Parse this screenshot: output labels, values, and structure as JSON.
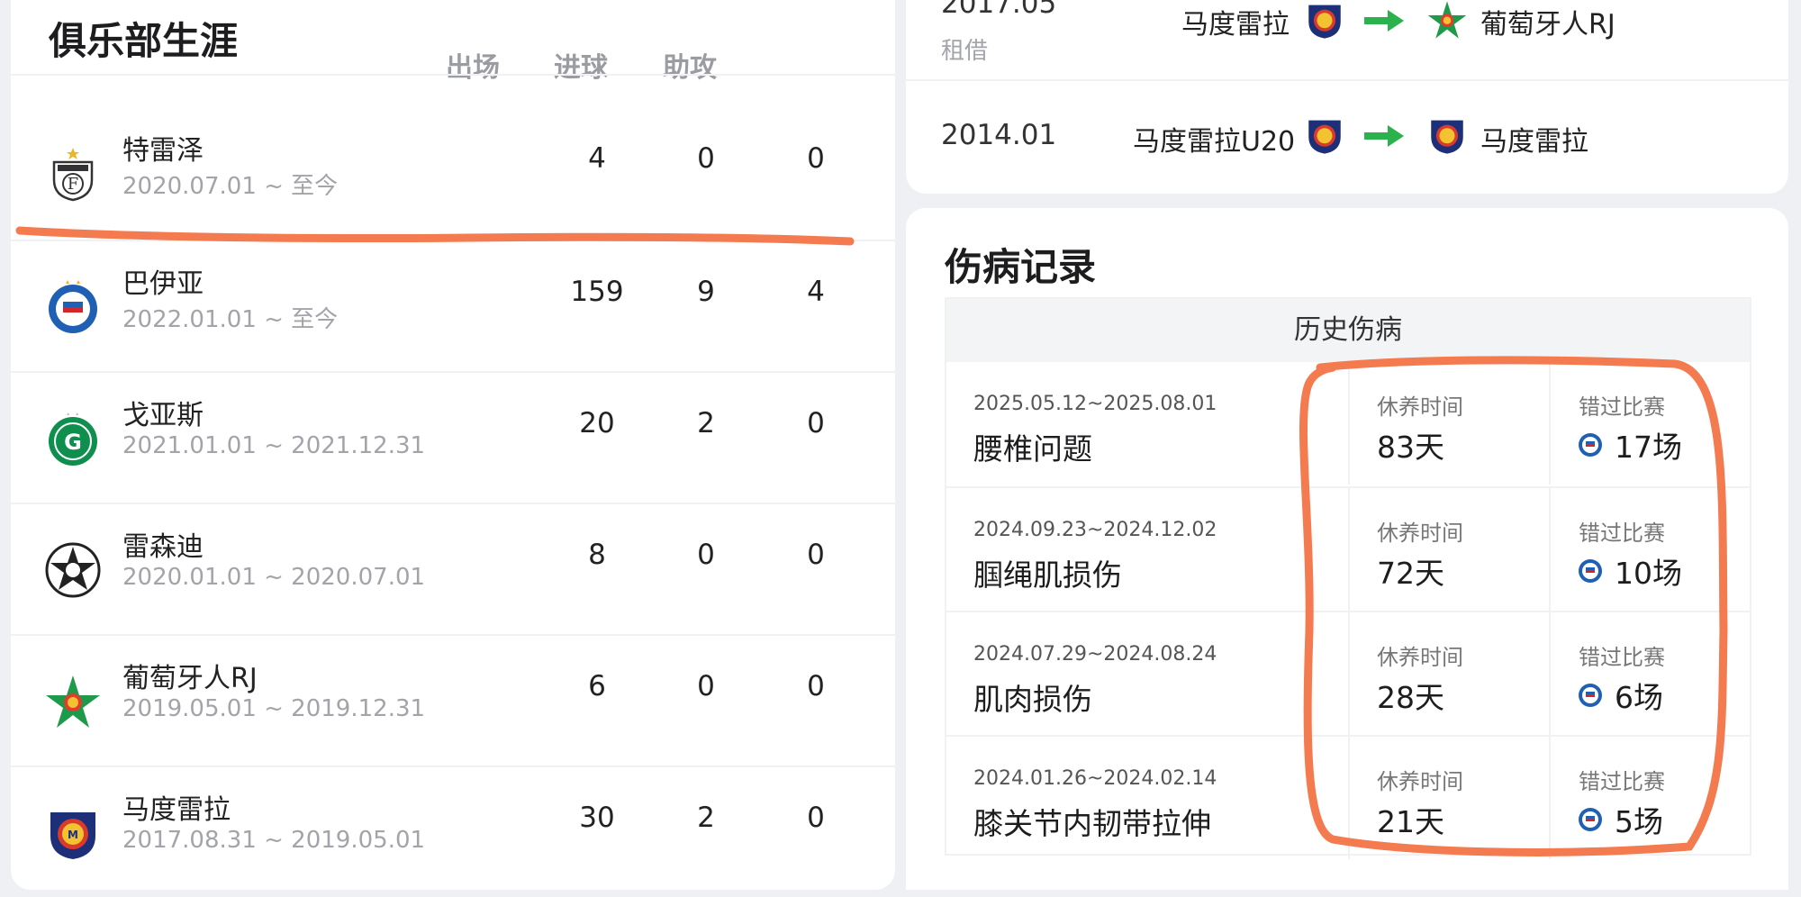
{
  "club_career": {
    "title": "俱乐部生涯",
    "columns": [
      "出场",
      "进球",
      "助攻"
    ],
    "clubs": [
      {
        "name": "特雷泽",
        "period": "2020.07.01 ~ 至今",
        "appearances": "4",
        "goals": "0",
        "assists": "0",
        "logo": "treze-crest-icon"
      },
      {
        "name": "巴伊亚",
        "period": "2022.01.01 ~ 至今",
        "appearances": "159",
        "goals": "9",
        "assists": "4",
        "logo": "bahia-crest-icon"
      },
      {
        "name": "戈亚斯",
        "period": "2021.01.01 ~ 2021.12.31",
        "appearances": "20",
        "goals": "2",
        "assists": "0",
        "logo": "goias-crest-icon"
      },
      {
        "name": "雷森迪",
        "period": "2020.01.01 ~ 2020.07.01",
        "appearances": "8",
        "goals": "0",
        "assists": "0",
        "logo": "resende-crest-icon"
      },
      {
        "name": "葡萄牙人RJ",
        "period": "2019.05.01 ~ 2019.12.31",
        "appearances": "6",
        "goals": "0",
        "assists": "0",
        "logo": "portuguesa-rj-crest-icon"
      },
      {
        "name": "马度雷拉",
        "period": "2017.08.31 ~ 2019.05.01",
        "appearances": "30",
        "goals": "2",
        "assists": "0",
        "logo": "madureira-crest-icon"
      }
    ]
  },
  "transfers": [
    {
      "date": "2017.05",
      "type": "租借",
      "from": "马度雷拉",
      "to": "葡萄牙人RJ"
    },
    {
      "date": "2014.01",
      "type": "",
      "from": "马度雷拉U20",
      "to": "马度雷拉"
    }
  ],
  "injuries": {
    "title": "伤病记录",
    "table_header": "历史伤病",
    "rest_label": "休养时间",
    "missed_label": "错过比赛",
    "rows": [
      {
        "dates": "2025.05.12~2025.08.01",
        "injury": "腰椎问题",
        "rest": "83天",
        "missed": "17场"
      },
      {
        "dates": "2024.09.23~2024.12.02",
        "injury": "腘绳肌损伤",
        "rest": "72天",
        "missed": "10场"
      },
      {
        "dates": "2024.07.29~2024.08.24",
        "injury": "肌肉损伤",
        "rest": "28天",
        "missed": "6场"
      },
      {
        "dates": "2024.01.26~2024.02.14",
        "injury": "膝关节内韧带拉伸",
        "rest": "21天",
        "missed": "5场"
      }
    ]
  },
  "colors": {
    "annotation": "#f47a4f",
    "arrow": "#2bb24c",
    "muted": "#a2a4a9"
  }
}
